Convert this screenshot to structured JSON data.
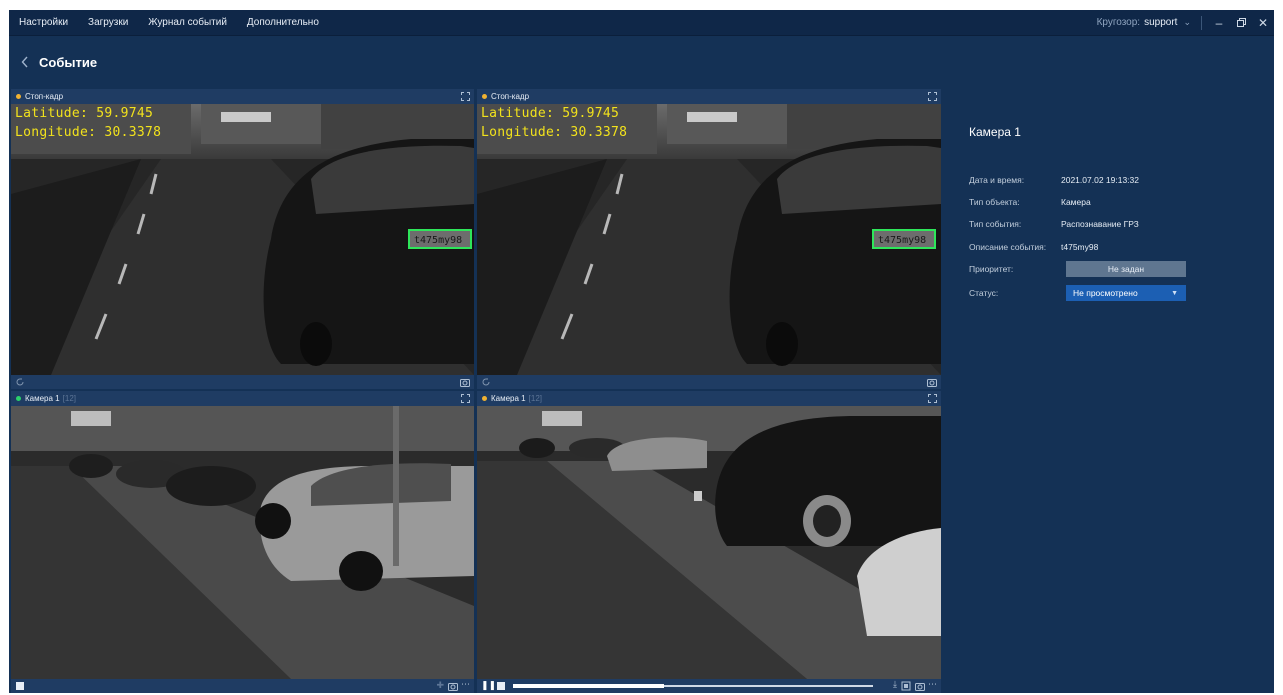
{
  "menu": {
    "items": [
      "Настройки",
      "Загрузки",
      "Журнал событий",
      "Дополнительно"
    ],
    "user_label": "Кругозор:",
    "user_name": "support"
  },
  "header": {
    "title": "Событие"
  },
  "tiles": [
    {
      "title": "Стоп-кадр",
      "sub": "",
      "dot_color": "#f0b232",
      "latitude": "Latitude: 59.9745",
      "longitude": "Longitude: 30.3378",
      "plate": "t475my98"
    },
    {
      "title": "Стоп-кадр",
      "sub": "",
      "dot_color": "#f0b232",
      "latitude": "Latitude: 59.9745",
      "longitude": "Longitude: 30.3378",
      "plate": "t475my98"
    },
    {
      "title": "Камера 1",
      "sub": "[12]",
      "dot_color": "#2bd16b"
    },
    {
      "title": "Камера 1",
      "sub": "[12]",
      "dot_color": "#f0b232"
    }
  ],
  "details": {
    "camera_title": "Камера 1",
    "rows": [
      {
        "label": "Дата и время:",
        "value": "2021.07.02 19:13:32"
      },
      {
        "label": "Тип объекта:",
        "value": "Камера"
      },
      {
        "label": "Тип события:",
        "value": "Распознавание ГРЗ"
      },
      {
        "label": "Описание события:",
        "value": "t475my98"
      }
    ],
    "priority_label": "Приоритет:",
    "priority_value": "Не задан",
    "status_label": "Статус:",
    "status_value": "Не просмотрено"
  },
  "playback": {
    "progress": 0.42
  },
  "colors": {
    "window_bg": "#143155",
    "menubar_bg": "#0f2748",
    "status_blue": "#1c5fb3",
    "plate_box": "#2ee65a",
    "overlay_text": "#f2e21c"
  }
}
